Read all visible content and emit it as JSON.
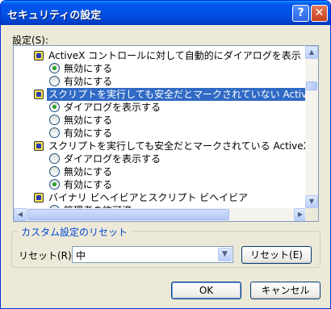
{
  "window": {
    "title": "セキュリティの設定",
    "help_label": "?",
    "close_label": "✕"
  },
  "settings_label": "設定(S):",
  "tree": {
    "rows": [
      {
        "kind": "header",
        "text": "ActiveX コントロールに対して自動的にダイアログを表示",
        "selected": false
      },
      {
        "kind": "option",
        "text": "無効にする",
        "checked": true
      },
      {
        "kind": "option",
        "text": "有効にする",
        "checked": false
      },
      {
        "kind": "header",
        "text": "スクリプトを実行しても安全だとマークされていない ActiveX コントロー",
        "selected": true
      },
      {
        "kind": "option",
        "text": "ダイアログを表示する",
        "checked": true
      },
      {
        "kind": "option",
        "text": "無効にする",
        "checked": false
      },
      {
        "kind": "option",
        "text": "有効にする",
        "checked": false
      },
      {
        "kind": "header",
        "text": "スクリプトを実行しても安全だとマークされている ActiveX コントロール",
        "selected": false
      },
      {
        "kind": "option",
        "text": "ダイアログを表示する",
        "checked": false
      },
      {
        "kind": "option",
        "text": "無効にする",
        "checked": false
      },
      {
        "kind": "option",
        "text": "有効にする",
        "checked": true
      },
      {
        "kind": "header",
        "text": "バイナリ ビヘイビアとスクリプト ビヘイビア",
        "selected": false
      },
      {
        "kind": "option",
        "text": "管理者の許可済",
        "checked": false
      }
    ],
    "scroll_up": "▲",
    "scroll_down": "▼",
    "scroll_left": "◀",
    "scroll_right": "▶"
  },
  "reset_group": {
    "legend": "カスタム設定のリセット",
    "label": "リセット(R):",
    "selected_value": "中",
    "dropdown_arrow": "▼",
    "reset_button": "リセット(E)"
  },
  "footer": {
    "ok_label": "OK",
    "cancel_label": "キャンセル"
  },
  "colors": {
    "titlebar": "#0055EA",
    "selection": "#316AC5",
    "radio_dot": "#21A121",
    "group_legend": "#0046D5"
  }
}
